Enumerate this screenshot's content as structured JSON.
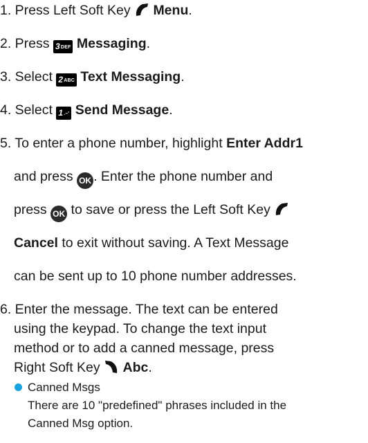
{
  "steps": {
    "s1": {
      "prefix": "1. Press Left Soft Key",
      "bold": "Menu",
      "suffix": "."
    },
    "s2": {
      "prefix": "2. Press",
      "key": "3",
      "key_sub": "DEF",
      "bold": "Messaging",
      "suffix": "."
    },
    "s3": {
      "prefix": "3. Select",
      "key": "2",
      "key_sub": "ABC",
      "bold": "Text Messaging",
      "suffix": "."
    },
    "s4": {
      "prefix": "4. Select",
      "key": "1",
      "key_sub": ".–'",
      "bold": "Send Message",
      "suffix": "."
    },
    "s5": {
      "l1_prefix": "5. To enter a phone number, highlight",
      "l1_bold": "Enter Addr1",
      "l2_prefix": "and press",
      "l2_suffix": ".  Enter the phone number and",
      "l3_prefix": "press",
      "l3_suffix": "to save or press the Left Soft Key",
      "l4_bold": "Cancel",
      "l4_suffix": "to exit without saving.  A Text Message",
      "l5": "can be sent up to 10 phone number addresses.",
      "ok_label": "OK"
    },
    "s6": {
      "l1": "6. Enter the message. The text can be entered",
      "l2": "using the keypad.  To change the text input",
      "l3": "method or to add a canned message, press",
      "l4_prefix": "Right Soft Key",
      "l4_bold": "Abc",
      "l4_suffix": "."
    }
  },
  "bullet": {
    "title": "Canned Msgs",
    "l1": "There are 10 \"predefined\" phrases included in the",
    "l2": "Canned Msg option."
  },
  "colors": {
    "text": "#1a1a1a",
    "bullet": "#1aa3e0"
  },
  "icons": {
    "left_soft_key": "left-soft-key-icon",
    "right_soft_key": "right-soft-key-icon",
    "ok": "ok-button-icon"
  }
}
